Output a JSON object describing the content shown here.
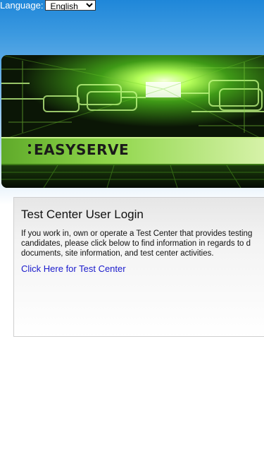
{
  "header": {
    "language_label": "Language:",
    "language_selected": "English"
  },
  "banner": {
    "title": "EASYSERVE"
  },
  "login": {
    "title": "Test Center User Login",
    "description_lines": [
      "If you work in, own or operate a Test Center that provides testing",
      "candidates,  please click below to find information in regards to d",
      "documents, site information,  and test center activities."
    ],
    "link_text": "Click Here for Test Center"
  },
  "colors": {
    "header_blue": "#1f87d9",
    "banner_green": "#7fd23a",
    "link_blue": "#1a1acc"
  }
}
